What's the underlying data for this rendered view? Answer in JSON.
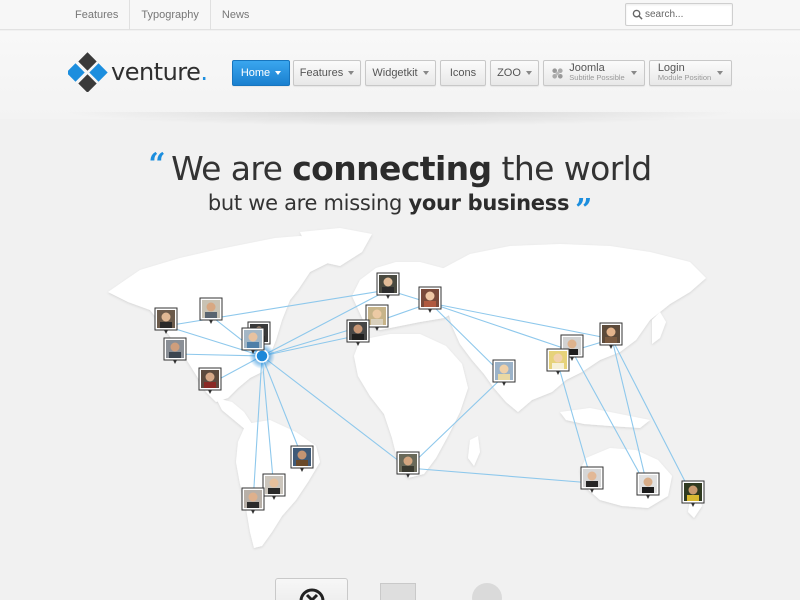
{
  "topbar": {
    "links": [
      "Features",
      "Typography",
      "News"
    ],
    "search_placeholder": "search..."
  },
  "logo": {
    "text": "venture",
    "dot": "."
  },
  "nav": {
    "home": "Home",
    "features": "Features",
    "widgetkit": "Widgetkit",
    "icons": "Icons",
    "zoo": "ZOO",
    "joomla": {
      "main": "Joomla",
      "sub": "Subtitle Possible"
    },
    "login": {
      "main": "Login",
      "sub": "Module Position"
    }
  },
  "headline": {
    "open_quote": "“",
    "line1_a": "We are ",
    "line1_b": "connecting",
    "line1_c": " the world",
    "line2_a": "but we are missing ",
    "line2_b": "your business",
    "close_quote": "”"
  },
  "colors": {
    "accent": "#1c8ede",
    "nav_active": "#2a93e0",
    "map_land": "#ffffff",
    "map_line": "#8ec8ec",
    "hub": "#1e88d8"
  },
  "icons": [
    "search-icon",
    "logo-mark-icon",
    "joomla-icon",
    "caret-down-icon",
    "avatar-pin-icon",
    "download-icon"
  ]
}
